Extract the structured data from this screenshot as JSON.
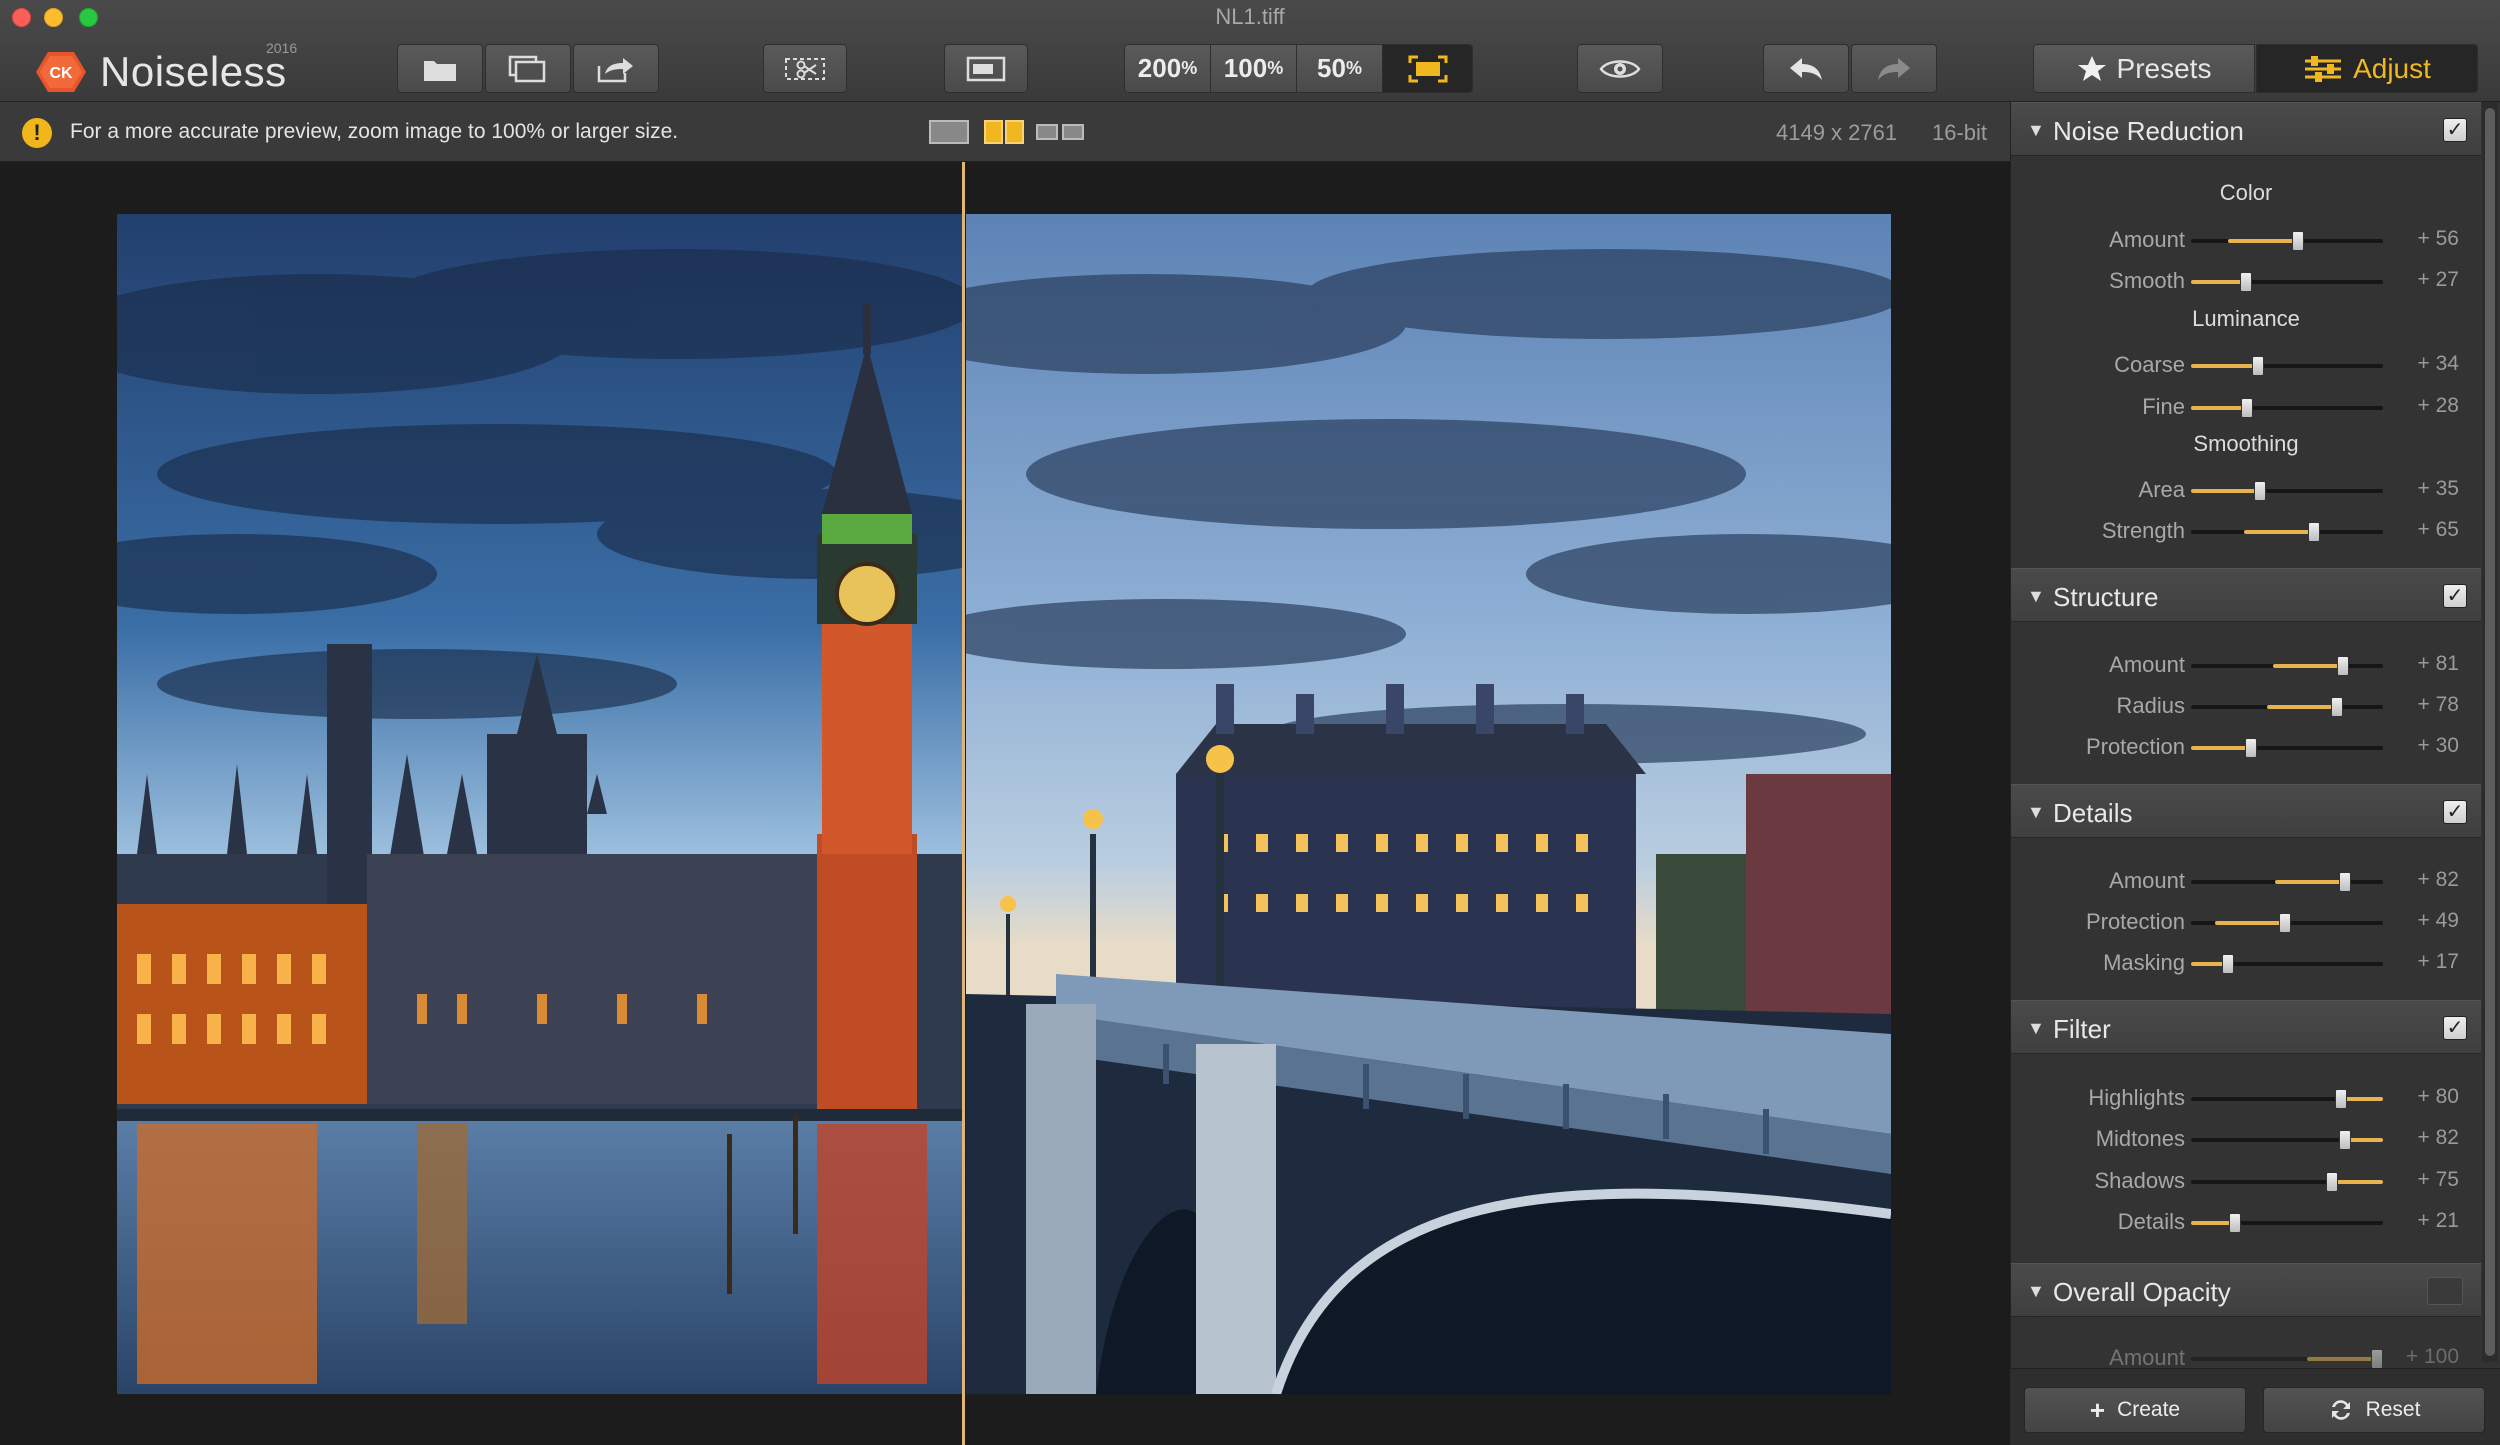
{
  "window": {
    "title": "NL1.tiff"
  },
  "app": {
    "name": "Noiseless",
    "badge": "CK",
    "year": "2016"
  },
  "toolbar": {
    "zoom": [
      {
        "label": "200",
        "unit": "%"
      },
      {
        "label": "100",
        "unit": "%"
      },
      {
        "label": "50",
        "unit": "%"
      }
    ],
    "presets_label": "Presets",
    "adjust_label": "Adjust",
    "icons": [
      "open-icon",
      "batch-icon",
      "export-icon",
      "crop-compare-icon",
      "single-view-icon",
      "fit-screen-icon",
      "preview-eye-icon",
      "undo-icon",
      "redo-icon"
    ]
  },
  "infobar": {
    "warning": "For a more accurate preview, zoom image to 100% or larger size.",
    "dimensions": "4149 x 2761",
    "bit_depth": "16-bit"
  },
  "panel": {
    "noise_reduction": {
      "title": "Noise Reduction",
      "enabled": true,
      "color_label": "Color",
      "color": [
        {
          "label": "Amount",
          "value": "+ 56",
          "level": 56
        },
        {
          "label": "Smooth",
          "value": "+ 27",
          "level": 27
        }
      ],
      "luminance_label": "Luminance",
      "luminance": [
        {
          "label": "Coarse",
          "value": "+ 34",
          "level": 34
        },
        {
          "label": "Fine",
          "value": "+ 28",
          "level": 28
        }
      ],
      "smoothing_label": "Smoothing",
      "smoothing": [
        {
          "label": "Area",
          "value": "+ 35",
          "level": 35
        },
        {
          "label": "Strength",
          "value": "+ 65",
          "level": 65
        }
      ]
    },
    "structure": {
      "title": "Structure",
      "enabled": true,
      "items": [
        {
          "label": "Amount",
          "value": "+ 81",
          "level": 81
        },
        {
          "label": "Radius",
          "value": "+ 78",
          "level": 78
        },
        {
          "label": "Protection",
          "value": "+ 30",
          "level": 30
        }
      ]
    },
    "details": {
      "title": "Details",
      "enabled": true,
      "items": [
        {
          "label": "Amount",
          "value": "+ 82",
          "level": 82
        },
        {
          "label": "Protection",
          "value": "+ 49",
          "level": 49
        },
        {
          "label": "Masking",
          "value": "+ 17",
          "level": 17
        }
      ]
    },
    "filter": {
      "title": "Filter",
      "enabled": true,
      "items": [
        {
          "label": "Highlights",
          "value": "+ 80",
          "level": 80
        },
        {
          "label": "Midtones",
          "value": "+ 82",
          "level": 82
        },
        {
          "label": "Shadows",
          "value": "+ 75",
          "level": 75
        },
        {
          "label": "Details",
          "value": "+ 21",
          "level": 21
        }
      ]
    },
    "overall_opacity": {
      "title": "Overall Opacity",
      "enabled": false,
      "items": [
        {
          "label": "Amount",
          "value": "+ 100",
          "level": 100
        }
      ]
    }
  },
  "footer": {
    "create_label": "Create",
    "reset_label": "Reset"
  },
  "colors": {
    "accent": "#f0b81e",
    "slider_fill": "#e6b34f",
    "divider": "#e0b678"
  }
}
